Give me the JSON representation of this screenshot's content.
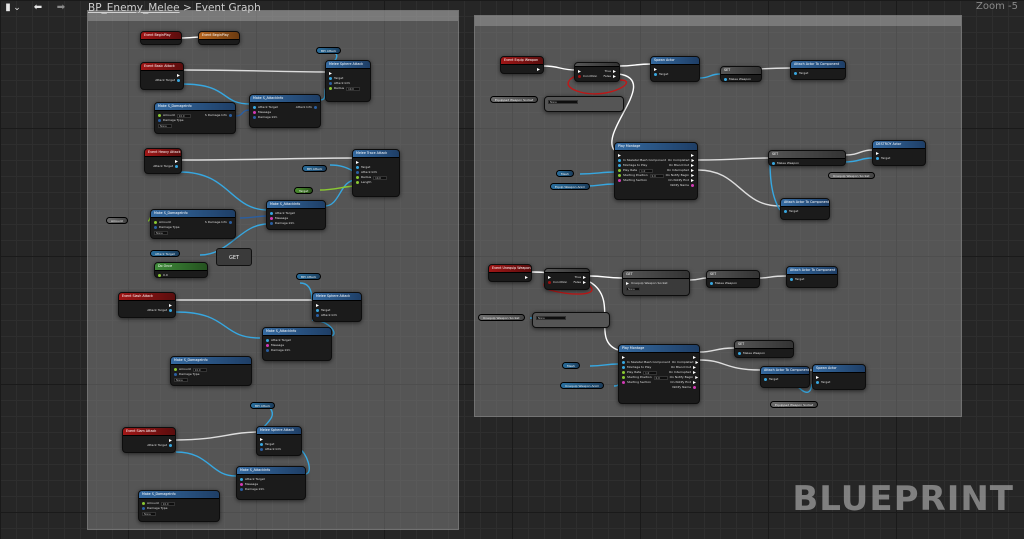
{
  "toolbar": {
    "menu_icon": "▮",
    "dropdown_icon": "⌄",
    "back_icon": "⬅",
    "forward_icon": "➡"
  },
  "breadcrumb": {
    "asset": "BP_Enemy_Melee",
    "separator": ">",
    "graph": "Event Graph"
  },
  "zoom_label": "Zoom -5",
  "watermark": "BLUEPRINT",
  "comment_boxes": [
    {
      "title": ""
    },
    {
      "title": ""
    }
  ],
  "nodes": {
    "ev_begin": "Event BeginPlay",
    "ev_parent": "Event BeginPlay",
    "ev_melee1": "Event Basic Attack",
    "ev_melee2": "Event Heavy Attack",
    "ev_melee3": "Event Slash Attack",
    "ev_melee4": "Event Slam Attack",
    "ev_equip": "Event Equip Weapon",
    "ev_unequip": "Event Unequip Weapon",
    "attack_target": "Attack Target",
    "make_damage": "Make S_DamageInfo",
    "make_attack": "Make S_AttackInfo",
    "amount": "Amount",
    "damage_type": "Damage Type",
    "damage_info": "S Damage Info",
    "target": "Target",
    "attack_info": "Attack Info",
    "radius": "Radius",
    "length": "Length",
    "message": "Message",
    "damage_info_pin": "Damage Info",
    "get": "GET",
    "notify": "Do Once",
    "bpi_attack": "BPI Attack",
    "melee_sphere": "Melee Sphere Attack",
    "melee_trace": "Melee Trace Attack",
    "weapon_class": "Melee Weapon Class",
    "set_weapon": "SET",
    "melee_weapon": "Melee Weapon",
    "equip": "Equip",
    "unequip": "Unequip",
    "gate": "Is Valid",
    "condition": "Condition",
    "true": "True",
    "false": "False",
    "spawn": "Spawn Actor",
    "attach": "Attach Actor To Component",
    "play_montage": "Play Montage",
    "in_skeletal": "In Skeletal Mesh Component",
    "montage_to_play": "Montage to Play",
    "play_rate": "Play Rate",
    "starting_position": "Starting Position",
    "starting_section": "Starting Section",
    "on_completed": "On Completed",
    "on_blend_out": "On Blend Out",
    "on_interrupted": "On Interrupted",
    "on_notify_begin": "On Notify Begin",
    "on_notify_end": "On Notify End",
    "notify_name": "Notify Name",
    "destroy": "DESTROY Actor",
    "mesh": "Mesh",
    "equip_montage": "Equip Weapon Anim",
    "unequip_montage": "Unequip Weapon Anim",
    "equipped_socket": "Equipped Weapon Socket",
    "unequipped_socket": "Unequip Weapon Socket",
    "none": "None",
    "val_10": "10.0",
    "val_1": "1.0",
    "val_0": "0.0"
  },
  "colors": {
    "exec_wire": "#ffffff",
    "object_wire": "#37a7e0",
    "struct_wire": "#2a5ea0",
    "bool_wire": "#c01818",
    "float_wire": "#8ac832",
    "event_header": "#a01616",
    "function_header": "#356aa0",
    "pure_header": "#3f8a3a"
  }
}
